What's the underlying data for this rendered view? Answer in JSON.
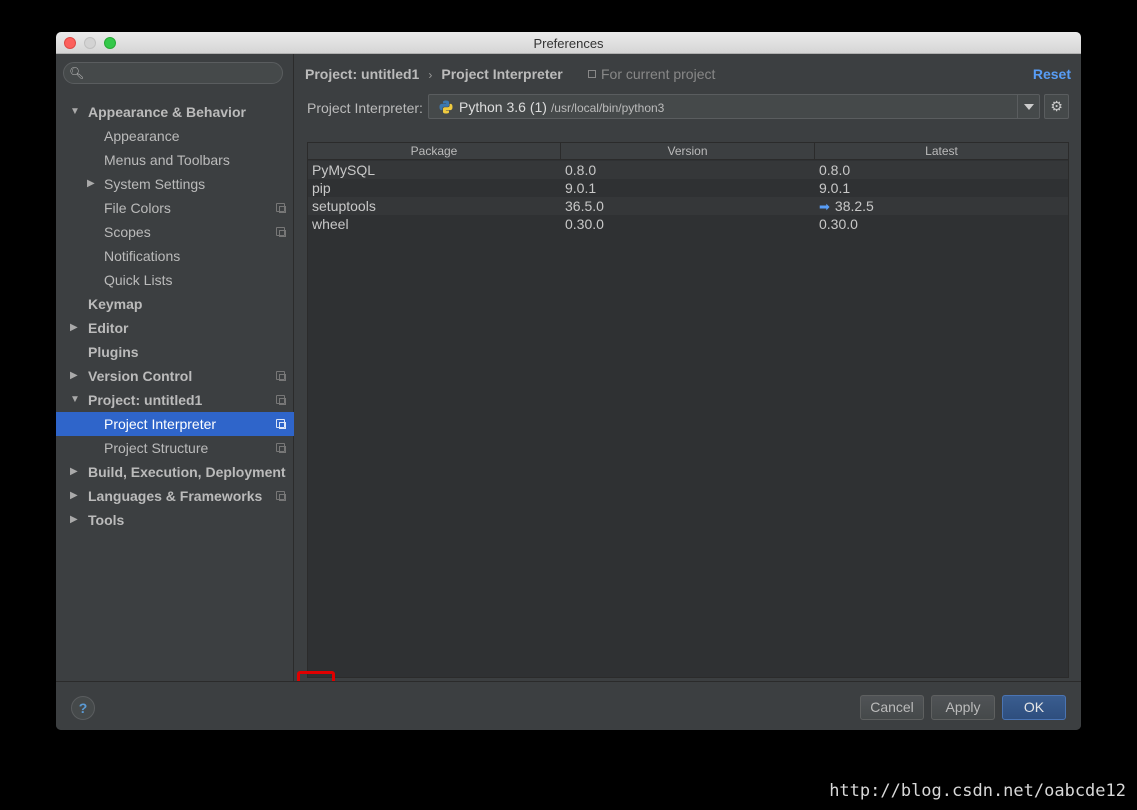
{
  "window": {
    "title": "Preferences"
  },
  "sidebar": {
    "search": {
      "value": "",
      "placeholder": ""
    },
    "items": [
      {
        "label": "Appearance & Behavior",
        "level": 0,
        "bold": true,
        "arrow": "expanded",
        "copy": false,
        "selected": false
      },
      {
        "label": "Appearance",
        "level": 1,
        "bold": false,
        "arrow": "none",
        "copy": false,
        "selected": false
      },
      {
        "label": "Menus and Toolbars",
        "level": 1,
        "bold": false,
        "arrow": "none",
        "copy": false,
        "selected": false
      },
      {
        "label": "System Settings",
        "level": 1,
        "bold": false,
        "arrow": "collapsed",
        "copy": false,
        "selected": false
      },
      {
        "label": "File Colors",
        "level": 1,
        "bold": false,
        "arrow": "none",
        "copy": true,
        "selected": false
      },
      {
        "label": "Scopes",
        "level": 1,
        "bold": false,
        "arrow": "none",
        "copy": true,
        "selected": false
      },
      {
        "label": "Notifications",
        "level": 1,
        "bold": false,
        "arrow": "none",
        "copy": false,
        "selected": false
      },
      {
        "label": "Quick Lists",
        "level": 1,
        "bold": false,
        "arrow": "none",
        "copy": false,
        "selected": false
      },
      {
        "label": "Keymap",
        "level": 0,
        "bold": true,
        "arrow": "none",
        "copy": false,
        "selected": false
      },
      {
        "label": "Editor",
        "level": 0,
        "bold": true,
        "arrow": "collapsed",
        "copy": false,
        "selected": false
      },
      {
        "label": "Plugins",
        "level": 0,
        "bold": true,
        "arrow": "none",
        "copy": false,
        "selected": false
      },
      {
        "label": "Version Control",
        "level": 0,
        "bold": true,
        "arrow": "collapsed",
        "copy": true,
        "selected": false
      },
      {
        "label": "Project: untitled1",
        "level": 0,
        "bold": true,
        "arrow": "expanded",
        "copy": true,
        "selected": false
      },
      {
        "label": "Project Interpreter",
        "level": 1,
        "bold": false,
        "arrow": "none",
        "copy": true,
        "selected": true
      },
      {
        "label": "Project Structure",
        "level": 1,
        "bold": false,
        "arrow": "none",
        "copy": true,
        "selected": false
      },
      {
        "label": "Build, Execution, Deployment",
        "level": 0,
        "bold": true,
        "arrow": "collapsed",
        "copy": false,
        "selected": false
      },
      {
        "label": "Languages & Frameworks",
        "level": 0,
        "bold": true,
        "arrow": "collapsed",
        "copy": true,
        "selected": false
      },
      {
        "label": "Tools",
        "level": 0,
        "bold": true,
        "arrow": "collapsed",
        "copy": false,
        "selected": false
      }
    ]
  },
  "header": {
    "breadcrumb": [
      "Project: untitled1",
      "Project Interpreter"
    ],
    "scope": "For current project",
    "reset_label": "Reset"
  },
  "interpreter": {
    "label": "Project Interpreter:",
    "name": "Python 3.6 (1)",
    "path": "/usr/local/bin/python3"
  },
  "packages": {
    "columns": [
      "Package",
      "Version",
      "Latest"
    ],
    "rows": [
      {
        "package": "PyMySQL",
        "version": "0.8.0",
        "latest": "0.8.0",
        "upgrade": false
      },
      {
        "package": "pip",
        "version": "9.0.1",
        "latest": "9.0.1",
        "upgrade": false
      },
      {
        "package": "setuptools",
        "version": "36.5.0",
        "latest": "38.2.5",
        "upgrade": true
      },
      {
        "package": "wheel",
        "version": "0.30.0",
        "latest": "0.30.0",
        "upgrade": false
      }
    ]
  },
  "toolbar": {
    "add": "+",
    "remove": "−",
    "upgrade": "▲"
  },
  "footer": {
    "help": "?",
    "cancel": "Cancel",
    "apply": "Apply",
    "ok": "OK"
  },
  "watermark": "http://blog.csdn.net/oabcde12",
  "colors": {
    "selection": "#2f65ca",
    "link": "#589df6",
    "highlight": "#e00000"
  }
}
